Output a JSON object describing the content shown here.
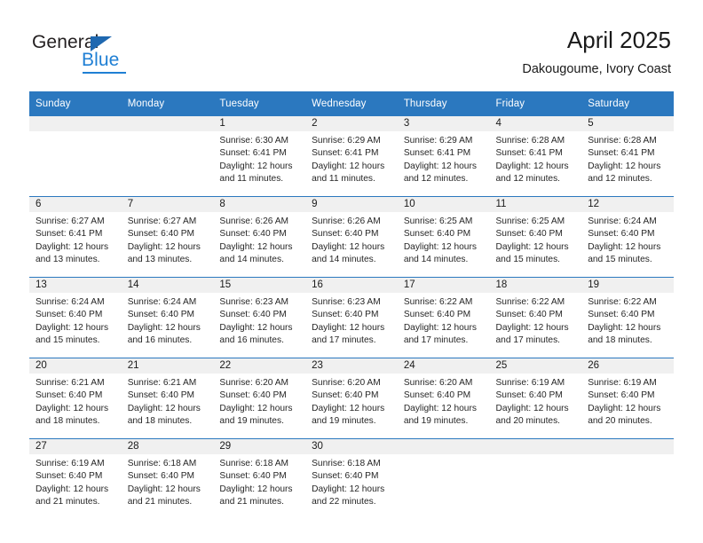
{
  "logo": {
    "word_one": "General",
    "word_two": "Blue",
    "triangle_color": "#1f68b0",
    "blue_color": "#1f7fd4"
  },
  "header": {
    "month_title": "April 2025",
    "location": "Dakougoume, Ivory Coast"
  },
  "theme": {
    "header_blue": "#2b78bf",
    "daynum_band": "#f0f0f0",
    "text": "#262626"
  },
  "calendar": {
    "weekday_headers": [
      "Sunday",
      "Monday",
      "Tuesday",
      "Wednesday",
      "Thursday",
      "Friday",
      "Saturday"
    ],
    "labels": {
      "sunrise": "Sunrise:",
      "sunset": "Sunset:",
      "daylight": "Daylight:"
    },
    "weeks": [
      [
        {
          "day": "",
          "empty": true
        },
        {
          "day": "",
          "empty": true
        },
        {
          "day": "1",
          "sunrise": "Sunrise: 6:30 AM",
          "sunset": "Sunset: 6:41 PM",
          "daylight_l1": "Daylight: 12 hours",
          "daylight_l2": "and 11 minutes."
        },
        {
          "day": "2",
          "sunrise": "Sunrise: 6:29 AM",
          "sunset": "Sunset: 6:41 PM",
          "daylight_l1": "Daylight: 12 hours",
          "daylight_l2": "and 11 minutes."
        },
        {
          "day": "3",
          "sunrise": "Sunrise: 6:29 AM",
          "sunset": "Sunset: 6:41 PM",
          "daylight_l1": "Daylight: 12 hours",
          "daylight_l2": "and 12 minutes."
        },
        {
          "day": "4",
          "sunrise": "Sunrise: 6:28 AM",
          "sunset": "Sunset: 6:41 PM",
          "daylight_l1": "Daylight: 12 hours",
          "daylight_l2": "and 12 minutes."
        },
        {
          "day": "5",
          "sunrise": "Sunrise: 6:28 AM",
          "sunset": "Sunset: 6:41 PM",
          "daylight_l1": "Daylight: 12 hours",
          "daylight_l2": "and 12 minutes."
        }
      ],
      [
        {
          "day": "6",
          "sunrise": "Sunrise: 6:27 AM",
          "sunset": "Sunset: 6:41 PM",
          "daylight_l1": "Daylight: 12 hours",
          "daylight_l2": "and 13 minutes."
        },
        {
          "day": "7",
          "sunrise": "Sunrise: 6:27 AM",
          "sunset": "Sunset: 6:40 PM",
          "daylight_l1": "Daylight: 12 hours",
          "daylight_l2": "and 13 minutes."
        },
        {
          "day": "8",
          "sunrise": "Sunrise: 6:26 AM",
          "sunset": "Sunset: 6:40 PM",
          "daylight_l1": "Daylight: 12 hours",
          "daylight_l2": "and 14 minutes."
        },
        {
          "day": "9",
          "sunrise": "Sunrise: 6:26 AM",
          "sunset": "Sunset: 6:40 PM",
          "daylight_l1": "Daylight: 12 hours",
          "daylight_l2": "and 14 minutes."
        },
        {
          "day": "10",
          "sunrise": "Sunrise: 6:25 AM",
          "sunset": "Sunset: 6:40 PM",
          "daylight_l1": "Daylight: 12 hours",
          "daylight_l2": "and 14 minutes."
        },
        {
          "day": "11",
          "sunrise": "Sunrise: 6:25 AM",
          "sunset": "Sunset: 6:40 PM",
          "daylight_l1": "Daylight: 12 hours",
          "daylight_l2": "and 15 minutes."
        },
        {
          "day": "12",
          "sunrise": "Sunrise: 6:24 AM",
          "sunset": "Sunset: 6:40 PM",
          "daylight_l1": "Daylight: 12 hours",
          "daylight_l2": "and 15 minutes."
        }
      ],
      [
        {
          "day": "13",
          "sunrise": "Sunrise: 6:24 AM",
          "sunset": "Sunset: 6:40 PM",
          "daylight_l1": "Daylight: 12 hours",
          "daylight_l2": "and 15 minutes."
        },
        {
          "day": "14",
          "sunrise": "Sunrise: 6:24 AM",
          "sunset": "Sunset: 6:40 PM",
          "daylight_l1": "Daylight: 12 hours",
          "daylight_l2": "and 16 minutes."
        },
        {
          "day": "15",
          "sunrise": "Sunrise: 6:23 AM",
          "sunset": "Sunset: 6:40 PM",
          "daylight_l1": "Daylight: 12 hours",
          "daylight_l2": "and 16 minutes."
        },
        {
          "day": "16",
          "sunrise": "Sunrise: 6:23 AM",
          "sunset": "Sunset: 6:40 PM",
          "daylight_l1": "Daylight: 12 hours",
          "daylight_l2": "and 17 minutes."
        },
        {
          "day": "17",
          "sunrise": "Sunrise: 6:22 AM",
          "sunset": "Sunset: 6:40 PM",
          "daylight_l1": "Daylight: 12 hours",
          "daylight_l2": "and 17 minutes."
        },
        {
          "day": "18",
          "sunrise": "Sunrise: 6:22 AM",
          "sunset": "Sunset: 6:40 PM",
          "daylight_l1": "Daylight: 12 hours",
          "daylight_l2": "and 17 minutes."
        },
        {
          "day": "19",
          "sunrise": "Sunrise: 6:22 AM",
          "sunset": "Sunset: 6:40 PM",
          "daylight_l1": "Daylight: 12 hours",
          "daylight_l2": "and 18 minutes."
        }
      ],
      [
        {
          "day": "20",
          "sunrise": "Sunrise: 6:21 AM",
          "sunset": "Sunset: 6:40 PM",
          "daylight_l1": "Daylight: 12 hours",
          "daylight_l2": "and 18 minutes."
        },
        {
          "day": "21",
          "sunrise": "Sunrise: 6:21 AM",
          "sunset": "Sunset: 6:40 PM",
          "daylight_l1": "Daylight: 12 hours",
          "daylight_l2": "and 18 minutes."
        },
        {
          "day": "22",
          "sunrise": "Sunrise: 6:20 AM",
          "sunset": "Sunset: 6:40 PM",
          "daylight_l1": "Daylight: 12 hours",
          "daylight_l2": "and 19 minutes."
        },
        {
          "day": "23",
          "sunrise": "Sunrise: 6:20 AM",
          "sunset": "Sunset: 6:40 PM",
          "daylight_l1": "Daylight: 12 hours",
          "daylight_l2": "and 19 minutes."
        },
        {
          "day": "24",
          "sunrise": "Sunrise: 6:20 AM",
          "sunset": "Sunset: 6:40 PM",
          "daylight_l1": "Daylight: 12 hours",
          "daylight_l2": "and 19 minutes."
        },
        {
          "day": "25",
          "sunrise": "Sunrise: 6:19 AM",
          "sunset": "Sunset: 6:40 PM",
          "daylight_l1": "Daylight: 12 hours",
          "daylight_l2": "and 20 minutes."
        },
        {
          "day": "26",
          "sunrise": "Sunrise: 6:19 AM",
          "sunset": "Sunset: 6:40 PM",
          "daylight_l1": "Daylight: 12 hours",
          "daylight_l2": "and 20 minutes."
        }
      ],
      [
        {
          "day": "27",
          "sunrise": "Sunrise: 6:19 AM",
          "sunset": "Sunset: 6:40 PM",
          "daylight_l1": "Daylight: 12 hours",
          "daylight_l2": "and 21 minutes."
        },
        {
          "day": "28",
          "sunrise": "Sunrise: 6:18 AM",
          "sunset": "Sunset: 6:40 PM",
          "daylight_l1": "Daylight: 12 hours",
          "daylight_l2": "and 21 minutes."
        },
        {
          "day": "29",
          "sunrise": "Sunrise: 6:18 AM",
          "sunset": "Sunset: 6:40 PM",
          "daylight_l1": "Daylight: 12 hours",
          "daylight_l2": "and 21 minutes."
        },
        {
          "day": "30",
          "sunrise": "Sunrise: 6:18 AM",
          "sunset": "Sunset: 6:40 PM",
          "daylight_l1": "Daylight: 12 hours",
          "daylight_l2": "and 22 minutes."
        },
        {
          "day": "",
          "empty": true
        },
        {
          "day": "",
          "empty": true
        },
        {
          "day": "",
          "empty": true
        }
      ]
    ]
  }
}
